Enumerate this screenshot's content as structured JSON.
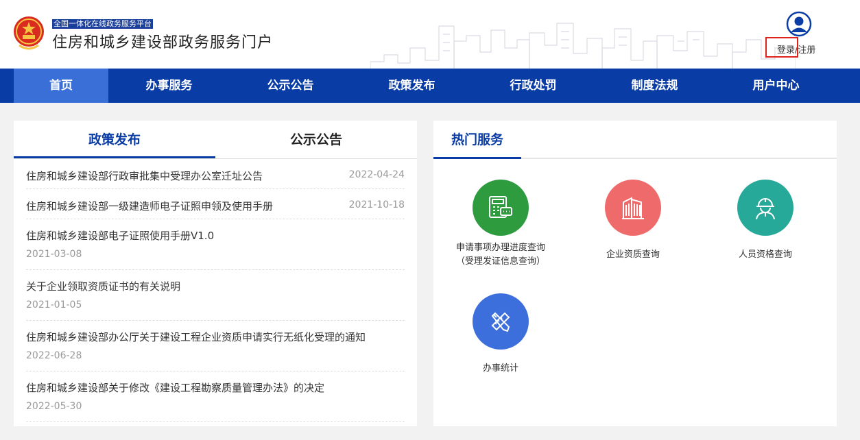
{
  "header": {
    "platform_tag": "全国一体化在线政务服务平台",
    "site_title": "住房和城乡建设部政务服务门户",
    "auth_login": "登录",
    "auth_sep": "/",
    "auth_register": "注册"
  },
  "nav": {
    "items": [
      "首页",
      "办事服务",
      "公示公告",
      "政策发布",
      "行政处罚",
      "制度法规",
      "用户中心"
    ],
    "active_index": 0
  },
  "left_panel": {
    "tabs": [
      "政策发布",
      "公示公告"
    ],
    "active_tab": 0,
    "news": [
      {
        "title": "住房和城乡建设部行政审批集中受理办公室迁址公告",
        "date": "2022-04-24"
      },
      {
        "title": "住房和城乡建设部一级建造师电子证照申领及使用手册",
        "date": "2021-10-18"
      },
      {
        "title": "住房和城乡建设部电子证照使用手册V1.0",
        "date": "2021-03-08"
      },
      {
        "title": "关于企业领取资质证书的有关说明",
        "date": "2021-01-05"
      },
      {
        "title": "住房和城乡建设部办公厅关于建设工程企业资质申请实行无纸化受理的通知",
        "date": "2022-06-28"
      },
      {
        "title": "住房和城乡建设部关于修改《建设工程勘察质量管理办法》的决定",
        "date": "2022-05-30"
      }
    ]
  },
  "hot_services": {
    "title": "热门服务",
    "items": [
      {
        "line1": "申请事项办理进度查询",
        "line2": "（受理发证信息查询）",
        "icon": "calculator-chat-icon",
        "color": "#2e9b3f"
      },
      {
        "line1": "企业资质查询",
        "line2": "",
        "icon": "building-icon",
        "color": "#ef6a6a"
      },
      {
        "line1": "人员资格查询",
        "line2": "",
        "icon": "worker-helmet-icon",
        "color": "#27a99a"
      },
      {
        "line1": "办事统计",
        "line2": "",
        "icon": "ruler-pencil-icon",
        "color": "#3d6fdc"
      }
    ]
  },
  "colors": {
    "nav_bg": "#0a3ca6",
    "nav_active": "#3a6fd8",
    "highlight_box": "#e0211b"
  }
}
